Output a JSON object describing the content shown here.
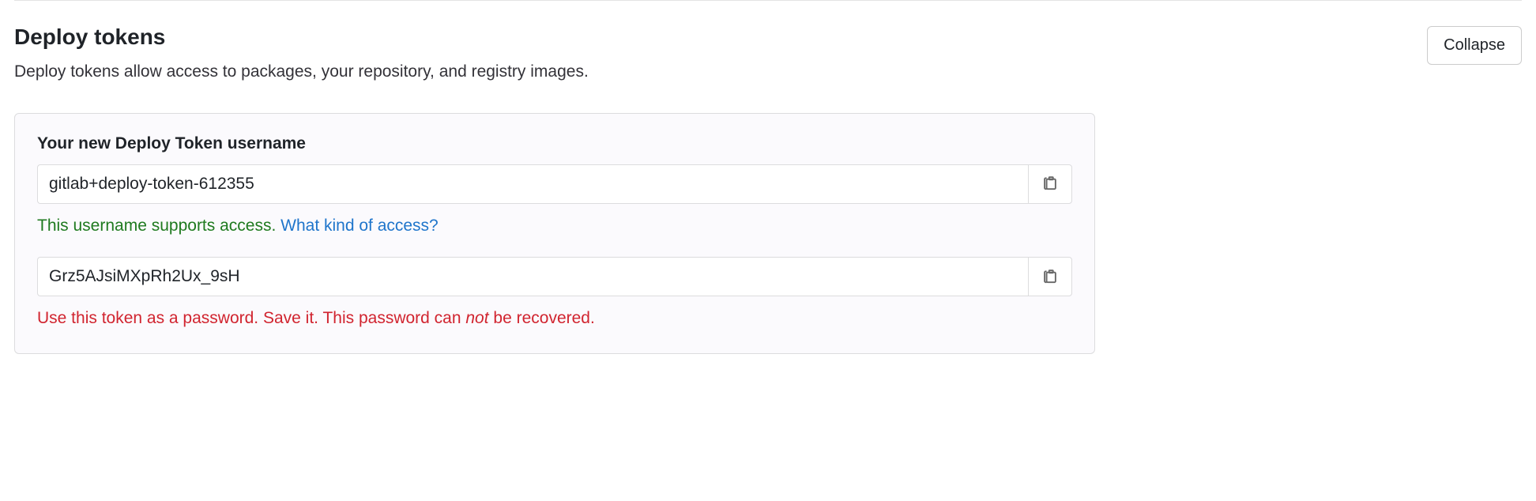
{
  "section": {
    "title": "Deploy tokens",
    "description": "Deploy tokens allow access to packages, your repository, and registry images.",
    "collapse_label": "Collapse"
  },
  "token_panel": {
    "username_label": "Your new Deploy Token username",
    "username_value": "gitlab+deploy-token-612355",
    "username_help_text": "This username supports access. ",
    "username_help_link": "What kind of access?",
    "token_value": "Grz5AJsiMXpRh2Ux_9sH",
    "token_warning_prefix": "Use this token as a password. Save it. This password can ",
    "token_warning_em": "not",
    "token_warning_suffix": " be recovered."
  }
}
